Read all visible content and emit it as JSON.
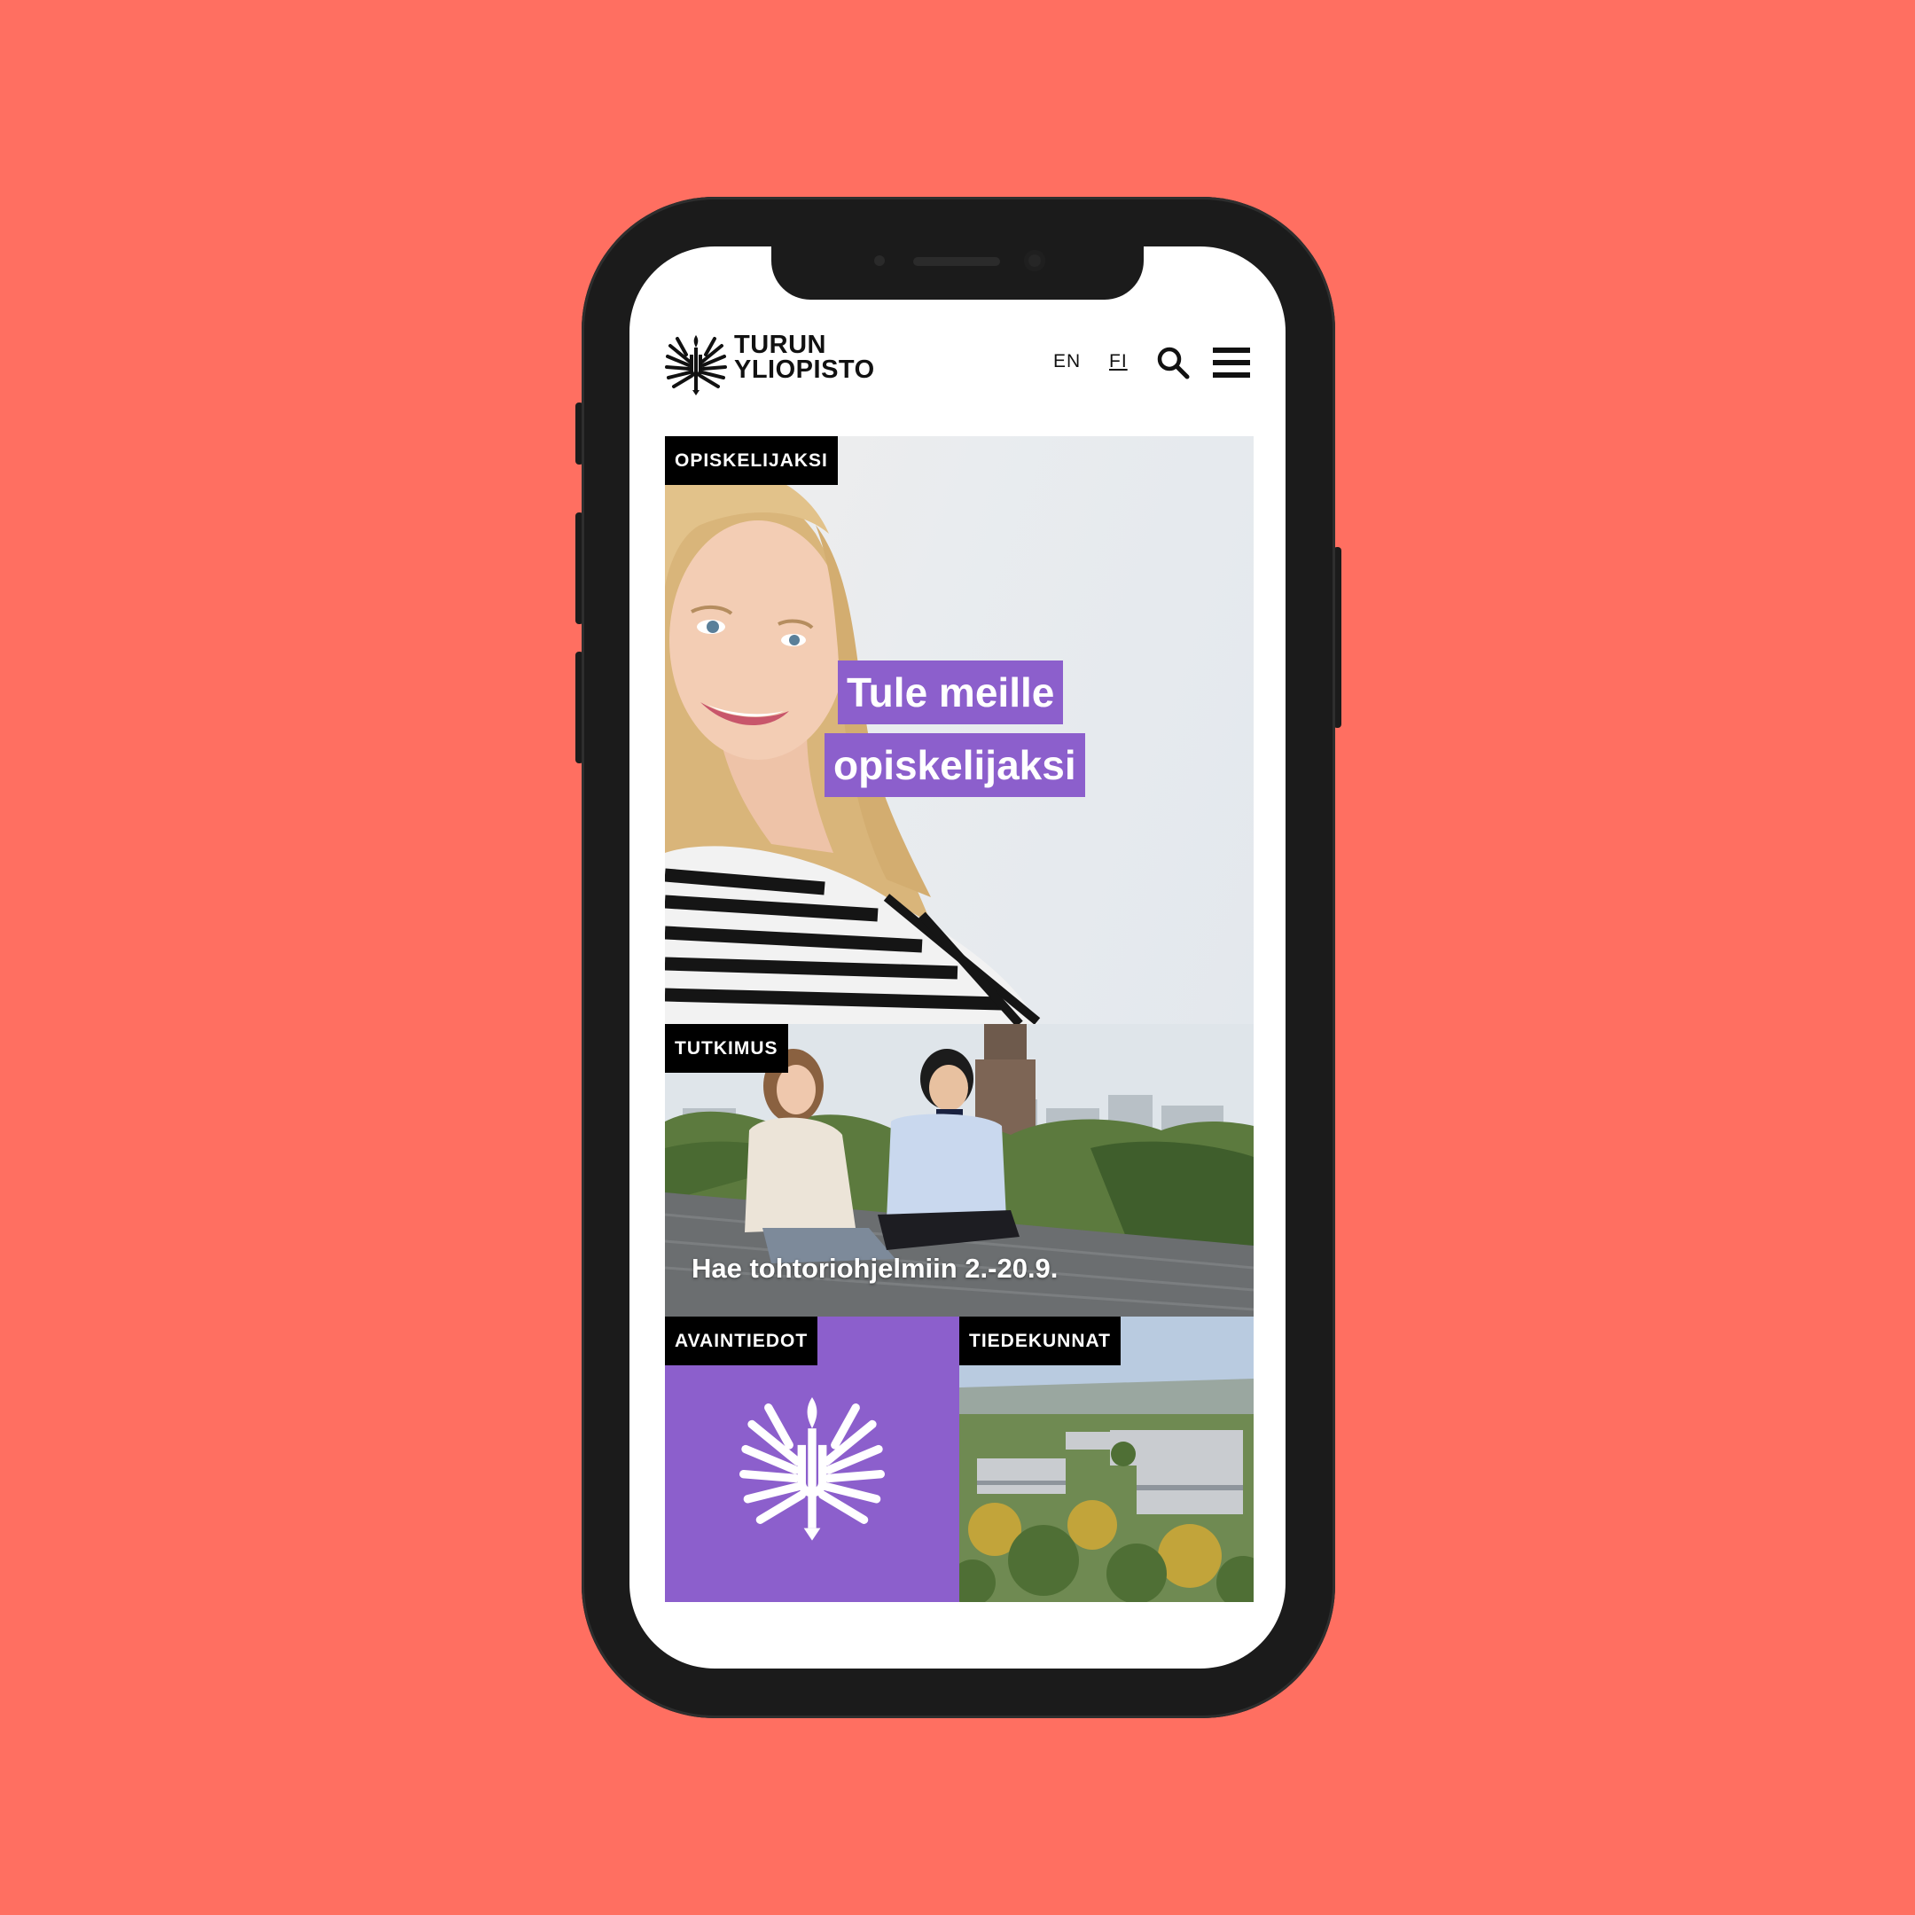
{
  "header": {
    "brand_line1": "TURUN",
    "brand_line2": "YLIOPISTO",
    "lang_en": "EN",
    "lang_fi": "FI"
  },
  "tiles": {
    "hero": {
      "tag": "OPISKELIJAKSI",
      "headline_line1": "Tule meille",
      "headline_line2": "opiskelijaksi"
    },
    "research": {
      "tag": "TUTKIMUS",
      "caption": "Hae tohtoriohjelmiin 2.-20.9."
    },
    "keyfacts": {
      "tag": "AVAINTIEDOT"
    },
    "faculties": {
      "tag": "TIEDEKUNNAT"
    }
  },
  "colors": {
    "background": "#ff6f61",
    "accent_purple": "#8c5fcc",
    "tag_black": "#000000"
  },
  "icons": [
    "university-emblem-icon",
    "search-icon",
    "hamburger-menu-icon"
  ]
}
